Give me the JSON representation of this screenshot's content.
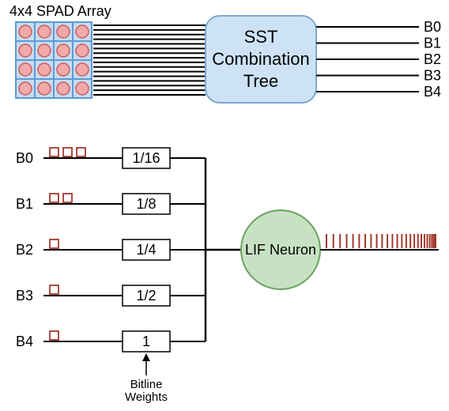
{
  "array_title": "4x4 SPAD Array",
  "sst_box": {
    "line1": "SST",
    "line2": "Combination",
    "line3": "Tree"
  },
  "outputs": [
    "B0",
    "B1",
    "B2",
    "B3",
    "B4"
  ],
  "bitlines": [
    {
      "name": "B0",
      "weight": "1/16",
      "pulses": 3
    },
    {
      "name": "B1",
      "weight": "1/8",
      "pulses": 2
    },
    {
      "name": "B2",
      "weight": "1/4",
      "pulses": 1
    },
    {
      "name": "B3",
      "weight": "1/2",
      "pulses": 1
    },
    {
      "name": "B4",
      "weight": "1",
      "pulses": 1
    }
  ],
  "weights_caption": "Bitline\nWeights",
  "neuron_label": "LIF Neuron",
  "colors": {
    "grid_line": "#5b9bd5",
    "grid_fill": "#c8dbf0",
    "spad_fill": "#f2a9a9",
    "spad_stroke": "#c85c5c",
    "sst_fill": "#cde3f5",
    "sst_stroke": "#7da9cf",
    "neuron_fill": "#c7e2c2",
    "neuron_stroke": "#6aa361",
    "spike": "#a23a2e",
    "line": "#000"
  }
}
